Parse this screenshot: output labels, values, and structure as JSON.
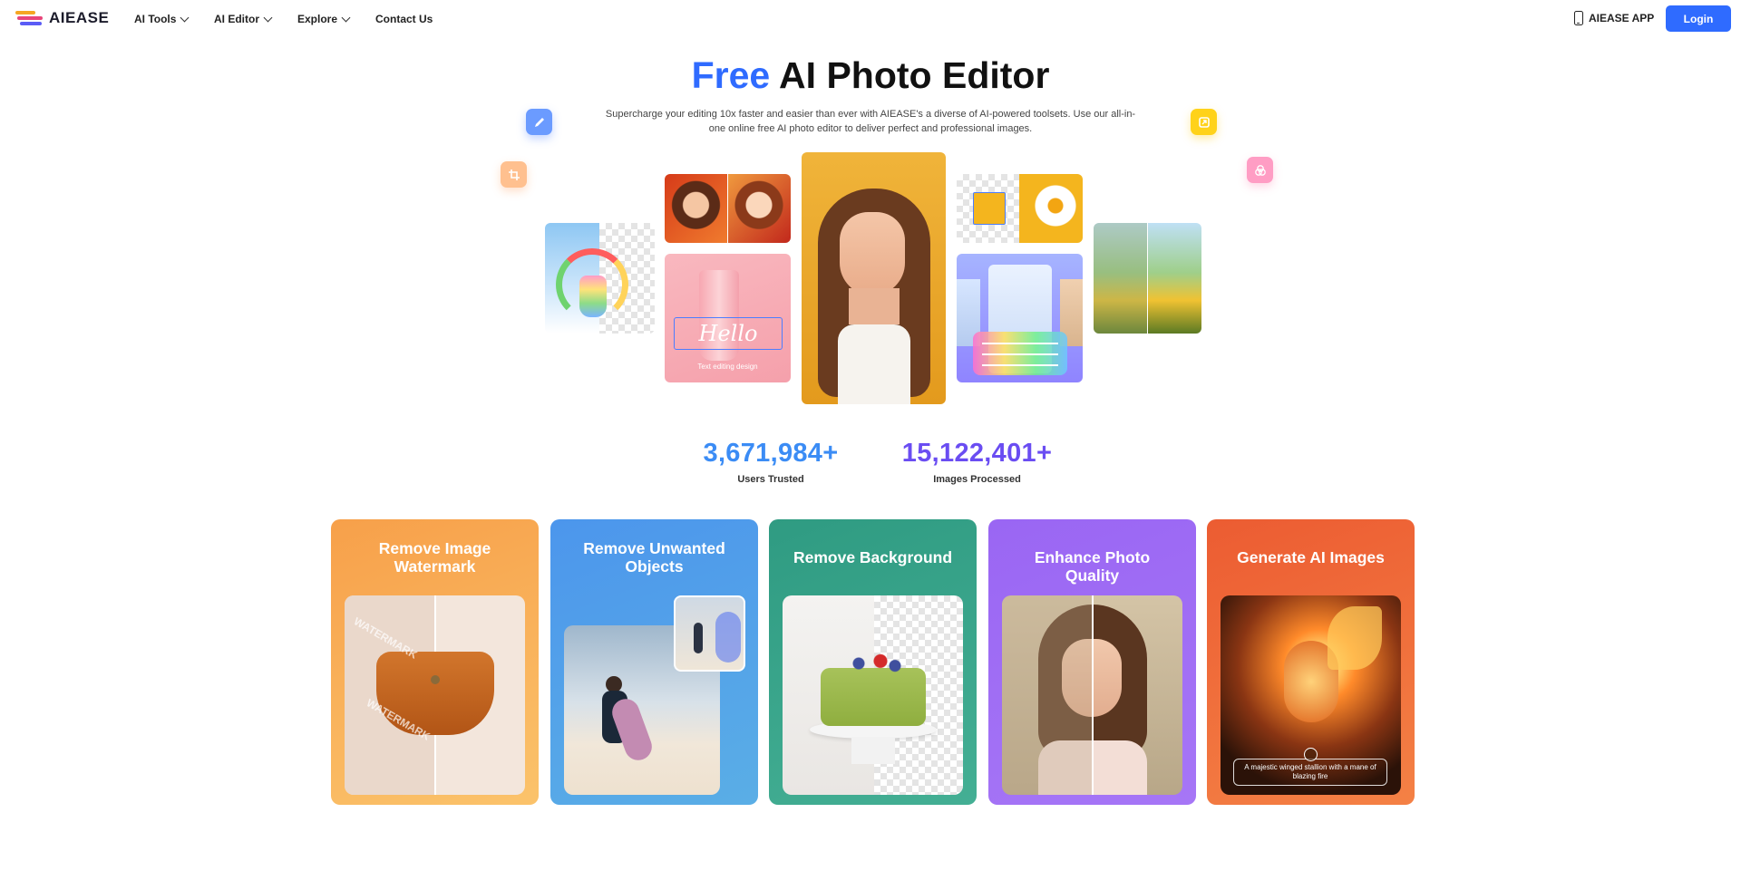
{
  "nav": {
    "logo_text": "AIEASE",
    "items": [
      {
        "label": "AI Tools"
      },
      {
        "label": "AI Editor"
      },
      {
        "label": "Explore"
      },
      {
        "label": "Contact Us"
      }
    ],
    "app_label": "AIEASE APP",
    "login_label": "Login"
  },
  "hero": {
    "title_accent": "Free",
    "title_rest": " AI Photo Editor",
    "subtitle": "Supercharge your editing 10x faster and easier than ever with AIEASE's a diverse of AI-powered toolsets. Use our all-in-one online free AI photo editor to deliver perfect and professional images.",
    "text_editing_caption": "Text editing design",
    "hello_text": "Hello"
  },
  "stats": [
    {
      "value": "3,671,984+",
      "label": "Users Trusted",
      "color": "#3b8cf5"
    },
    {
      "value": "15,122,401+",
      "label": "Images Processed",
      "color": "#6a4df2"
    }
  ],
  "cards": [
    {
      "title": "Remove Image Watermark",
      "watermark_text": "WATERMARK"
    },
    {
      "title": "Remove Unwanted Objects"
    },
    {
      "title": "Remove Background"
    },
    {
      "title": "Enhance Photo Quality"
    },
    {
      "title": "Generate AI Images",
      "prompt": "A majestic winged stallion with a mane of blazing fire"
    }
  ],
  "colors": {
    "brand_blue": "#2f6bff",
    "card_orange": "#f6a94b",
    "card_blue": "#4a9be8",
    "card_green": "#3aa58a",
    "card_purple": "#9b6df5",
    "card_red": "#ee6a3c"
  }
}
